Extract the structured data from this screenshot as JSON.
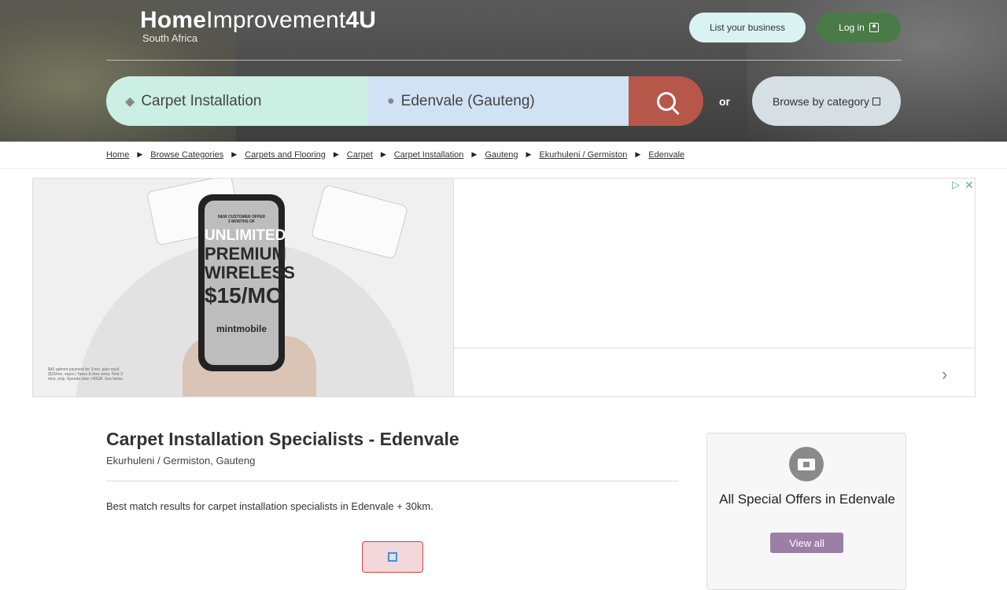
{
  "header": {
    "logo_bold": "Home",
    "logo_mid": "Improvement",
    "logo_suffix": "4U",
    "logo_sub": "South Africa",
    "list_business": "List your business",
    "login": "Log in"
  },
  "search": {
    "what_value": "Carpet Installation",
    "where_value": "Edenvale (Gauteng)",
    "or_label": "or",
    "browse_label": "Browse by category"
  },
  "breadcrumbs": [
    "Home",
    "Browse Categories",
    "Carpets and Flooring",
    "Carpet",
    "Carpet Installation",
    "Gauteng",
    "Ekurhuleni / Germiston",
    "Edenvale"
  ],
  "ad": {
    "phone_line1": "NEW CUSTOMER OFFER",
    "phone_line2": "3 MONTHS OF",
    "phone_line3": "UNLIMITED",
    "phone_line4": "PREMIUM",
    "phone_line5": "WIRELESS",
    "phone_price": "$15/MO",
    "phone_brand": "mintmobile",
    "fine_print": "$45 upfront payment for 3-mo. plan req'd ($15/mo. equiv.) Taxes & fees extra. First 3 mos. only. Speeds slow >40GB. See terms."
  },
  "main": {
    "title": "Carpet Installation Specialists - Edenvale",
    "location": "Ekurhuleni / Germiston, Gauteng",
    "description": "Best match results for carpet installation specialists in Edenvale + 30km."
  },
  "sidebar": {
    "title": "All Special Offers in Edenvale",
    "view_all": "View all"
  },
  "icons": {
    "tag": "tag-icon",
    "pin": "location-pin-icon",
    "search": "search-icon",
    "ticket": "ticket-icon"
  }
}
